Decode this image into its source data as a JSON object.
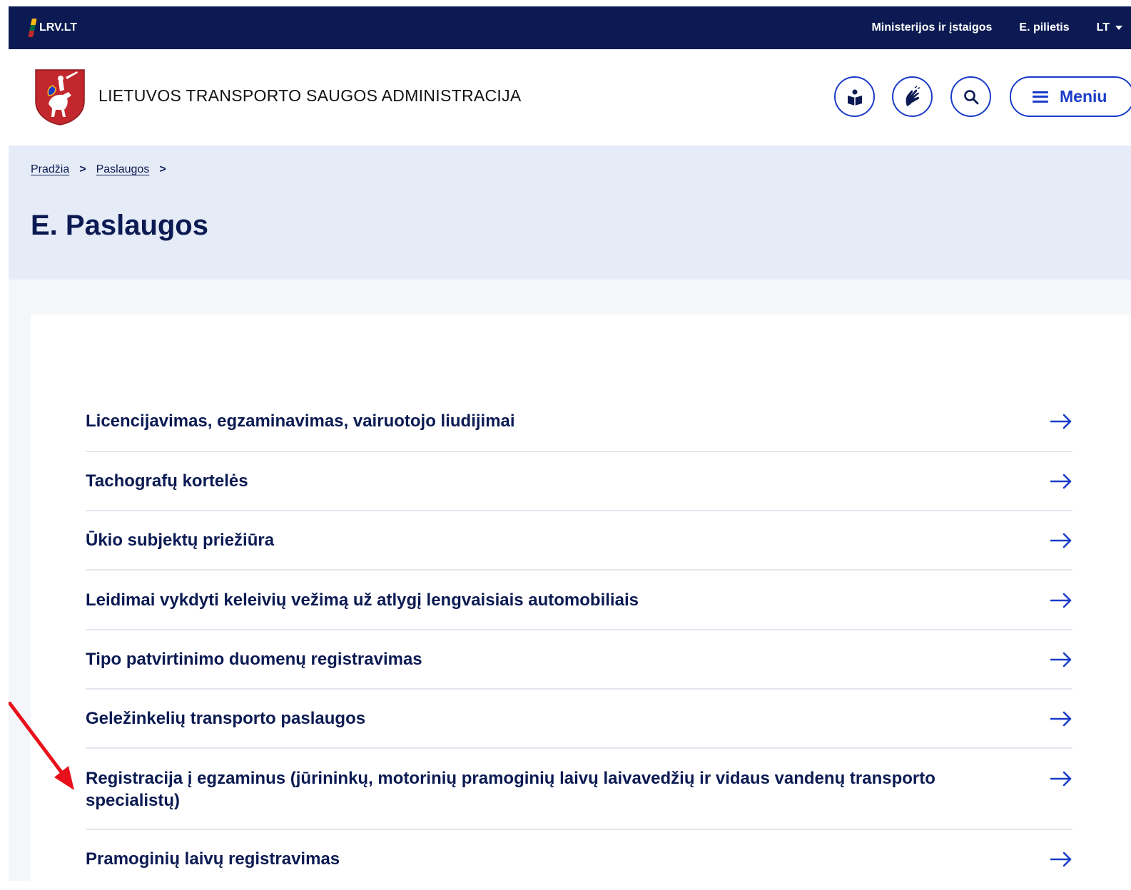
{
  "topbar": {
    "portal": "LRV.LT",
    "links": [
      "Ministerijos ir įstaigos",
      "E. pilietis"
    ],
    "language": "LT"
  },
  "header": {
    "org_name": "LIETUVOS TRANSPORTO SAUGOS ADMINISTRACIJA",
    "icons": [
      "easy-read-icon",
      "sign-language-icon",
      "search-icon"
    ],
    "menu_label": "Meniu"
  },
  "breadcrumb": [
    "Pradžia",
    "Paslaugos"
  ],
  "page_title": "E. Paslaugos",
  "services": [
    "Licencijavimas, egzaminavimas, vairuotojo liudijimai",
    "Tachografų kortelės",
    "Ūkio subjektų priežiūra",
    "Leidimai vykdyti keleivių vežimą už atlygį lengvaisiais automobiliais",
    "Tipo patvirtinimo duomenų registravimas",
    "Geležinkelių transporto paslaugos",
    "Registracija į egzaminus (jūrininkų, motorinių pramoginių laivų laivavedžių ir vidaus vandenų transporto specialistų)",
    "Pramoginių laivų registravimas"
  ],
  "colors": {
    "navy": "#0b1a52",
    "accent_blue": "#1a3cc8",
    "hero_bg": "#e6ecf7",
    "annotation_red": "#e8101a"
  }
}
